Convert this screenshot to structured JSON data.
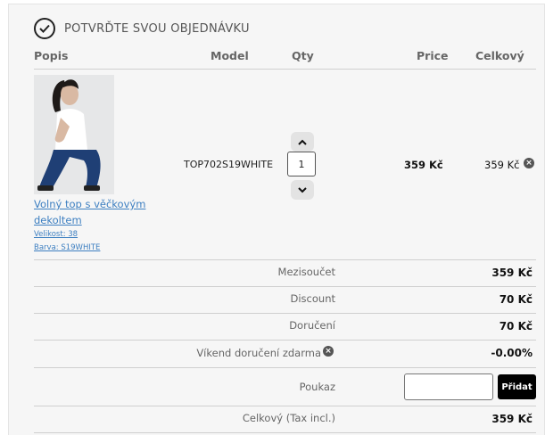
{
  "header": {
    "title": "POTVRĎTE SVOU OBJEDNÁVKU",
    "icon": "check-circle-icon"
  },
  "table": {
    "columns": {
      "description": "Popis",
      "model": "Model",
      "qty": "Qty",
      "price": "Price",
      "total": "Celkový"
    }
  },
  "product": {
    "name": "Volný top s věčkovým dekoltem",
    "size": "Velikost: 38",
    "color": "Barva: S19WHITE",
    "model": "TOP702S19WHITE",
    "qty": "1",
    "price": "359 Kč",
    "total": "359 Kč"
  },
  "summary": {
    "subtotal_label": "Mezisoučet",
    "subtotal_value": "359 Kč",
    "discount_label": "Discount",
    "discount_value": "70 Kč",
    "shipping_label": "Doručení",
    "shipping_value": "70 Kč",
    "weekend_label": "Víkend doručení zdarma",
    "weekend_value": "-0.00%",
    "voucher_label": "Poukaz",
    "voucher_value": "",
    "voucher_button": "Přidat",
    "grand_label": "Celkový (Tax incl.)",
    "grand_value": "359 Kč"
  },
  "colors": {
    "link": "#3d7fc1",
    "button": "#000000",
    "panel": "#f6f6f6"
  }
}
